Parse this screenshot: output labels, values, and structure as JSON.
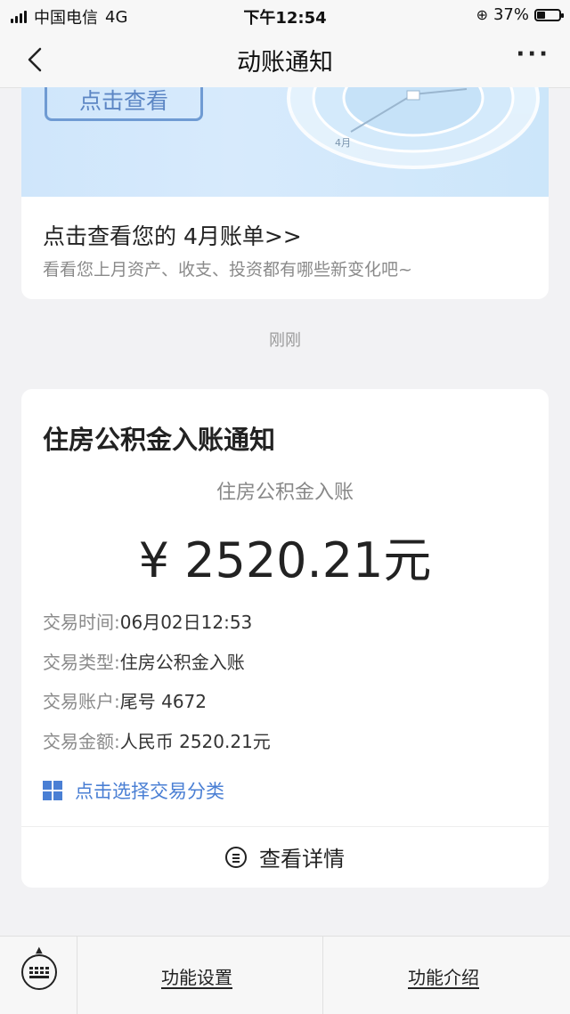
{
  "status_bar": {
    "carrier": "中国电信",
    "network": "4G",
    "time": "下午12:54",
    "battery_percent": "37%",
    "battery_level": 0.37
  },
  "nav": {
    "title": "动账通知",
    "back_icon": "chevron-left-icon",
    "more_icon": "more-dots-icon",
    "more_label": "···"
  },
  "bill_card": {
    "banner_button": "点击查看",
    "banner_clock_label": "4月",
    "headline": "点击查看您的 4月账单>>",
    "subtitle": "看看您上月资产、收支、投资都有哪些新变化吧~"
  },
  "timestamp": "刚刚",
  "notice": {
    "title": "住房公积金入账通知",
    "subtitle": "住房公积金入账",
    "amount": "¥ 2520.21元",
    "rows": [
      {
        "key": "交易时间:",
        "value": "06月02日12:53"
      },
      {
        "key": "交易类型:",
        "value": "住房公积金入账"
      },
      {
        "key": "交易账户:",
        "value": "尾号 4672"
      },
      {
        "key": "交易金额:",
        "value": "人民币 2520.21元"
      }
    ],
    "classify_label": "点击选择交易分类",
    "classify_icon": "grid-icon",
    "details_label": "查看详情",
    "details_icon": "list-circle-icon",
    "accent_color": "#4a7fd4"
  },
  "bottom_bar": {
    "keyboard_icon": "keyboard-icon",
    "tab1": "功能设置",
    "tab2": "功能介绍"
  }
}
